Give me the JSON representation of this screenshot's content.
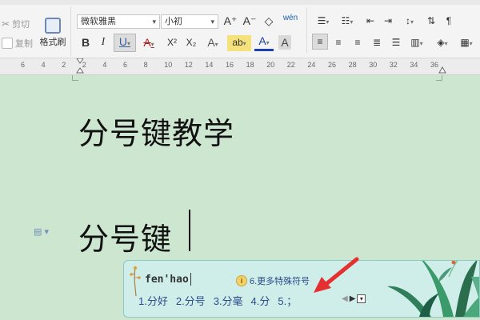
{
  "toolbar": {
    "clipboard": {
      "cut": "剪切",
      "copy": "复制",
      "format_painter": "格式刷"
    },
    "font_name": "微软雅黑",
    "font_size": "小初",
    "grow": "A⁺",
    "shrink": "A⁻",
    "clear": "⌫",
    "phonetic": "wén",
    "bold": "B",
    "italic": "I",
    "underline": "U",
    "strike": "A",
    "superscript": "X²",
    "subscript": "X₂",
    "effects": "A",
    "highlight": "ab",
    "font_color": "A",
    "char_shade": "A"
  },
  "ruler": {
    "ticks": [
      "6",
      "4",
      "2",
      "2",
      "4",
      "6",
      "8",
      "10",
      "12",
      "14",
      "16",
      "18",
      "20",
      "22",
      "24",
      "26",
      "28",
      "30",
      "32",
      "34",
      "36"
    ]
  },
  "document": {
    "title": "分号键教学",
    "line2": "分号键"
  },
  "ime": {
    "pinyin": "fen'hao",
    "more_symbols": "6.更多特殊符号",
    "candidates": [
      "1.分好",
      "2.分号",
      "3.分毫",
      "4.分",
      "5.；"
    ]
  },
  "colors": {
    "document_bg": "#cde6d0",
    "ime_bg": "#cfeeea",
    "annotation_arrow": "#e53030"
  }
}
